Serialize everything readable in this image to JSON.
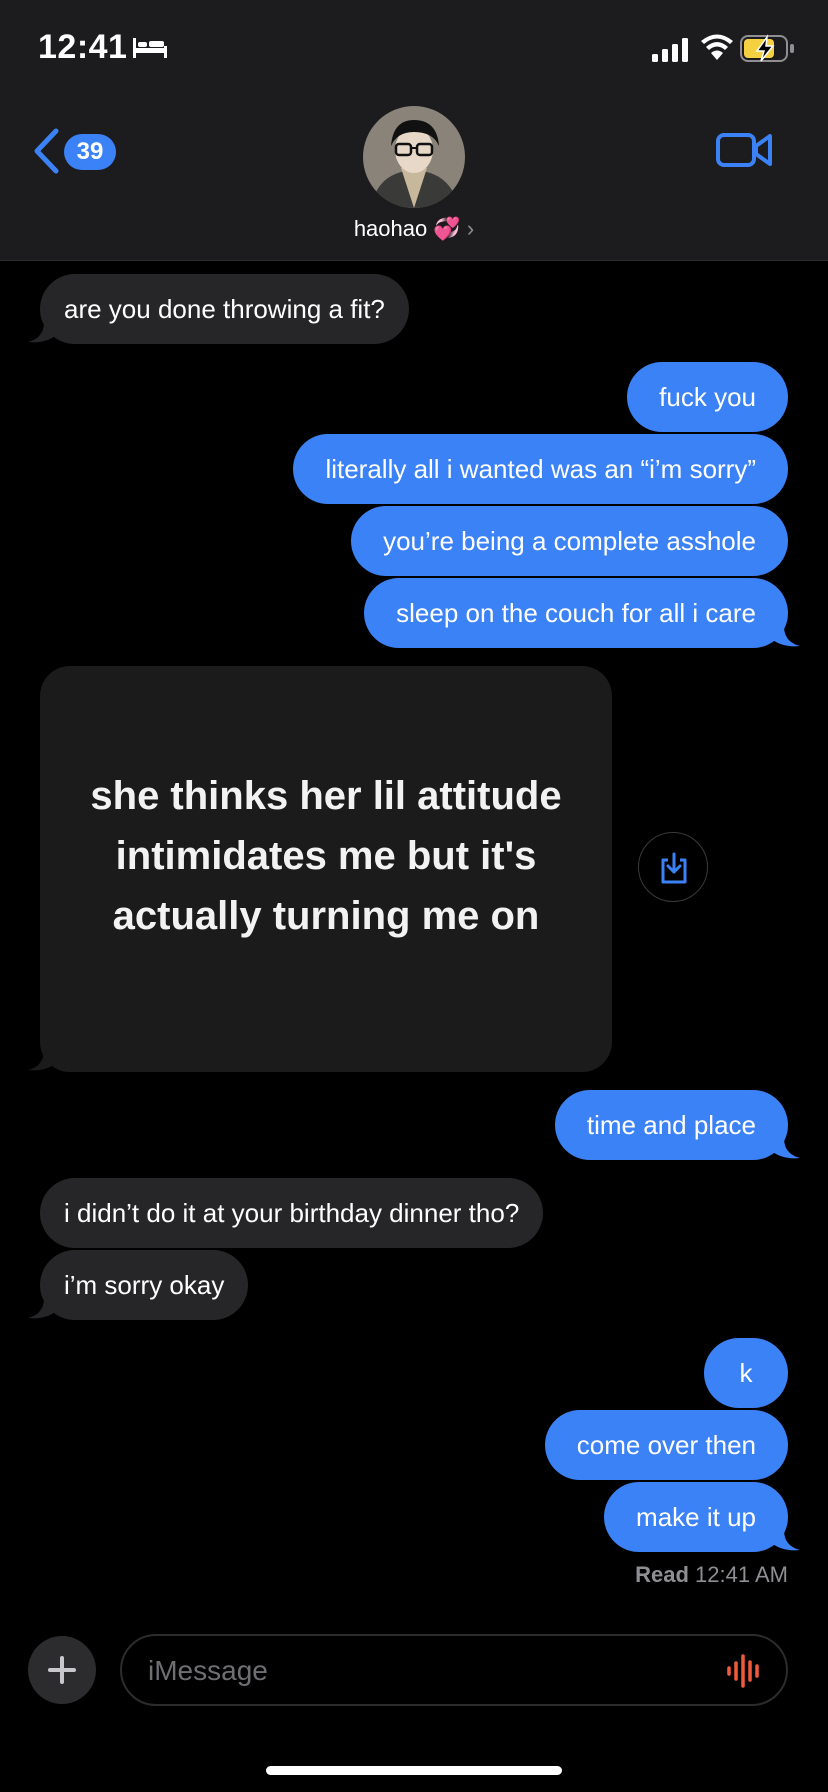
{
  "status_bar": {
    "time": "12:41",
    "icons": [
      "bed-icon",
      "cellular-signal-icon",
      "wifi-icon",
      "battery-charging-icon"
    ],
    "battery_color": "#f5d142"
  },
  "header": {
    "back_count": "39",
    "contact_name": "haohao 💞",
    "chevron": "›",
    "icons": [
      "back-chevron-icon",
      "facetime-video-icon"
    ],
    "accent_color": "#3b82f6"
  },
  "messages": [
    {
      "from": "them",
      "text": "are you done throwing a fit?"
    },
    {
      "from": "me",
      "text": "fuck you"
    },
    {
      "from": "me",
      "text": "literally all i wanted was an “i’m sorry”"
    },
    {
      "from": "me",
      "text": "you’re being a complete asshole"
    },
    {
      "from": "me",
      "text": "sleep on the couch for all i care"
    },
    {
      "from": "them",
      "type": "image",
      "text": "she thinks her lil attitude intimidates me but it's actually turning me on"
    },
    {
      "from": "me",
      "text": "time and place"
    },
    {
      "from": "them",
      "text": "i didn’t do it at your birthday dinner tho?"
    },
    {
      "from": "them",
      "text": "i’m sorry okay"
    },
    {
      "from": "me",
      "text": "k"
    },
    {
      "from": "me",
      "text": "come over then"
    },
    {
      "from": "me",
      "text": "make it up"
    }
  ],
  "read_receipt": {
    "label": "Read",
    "time": "12:41 AM"
  },
  "composer": {
    "placeholder": "iMessage",
    "icons": [
      "plus-icon",
      "audio-waveform-icon"
    ]
  }
}
